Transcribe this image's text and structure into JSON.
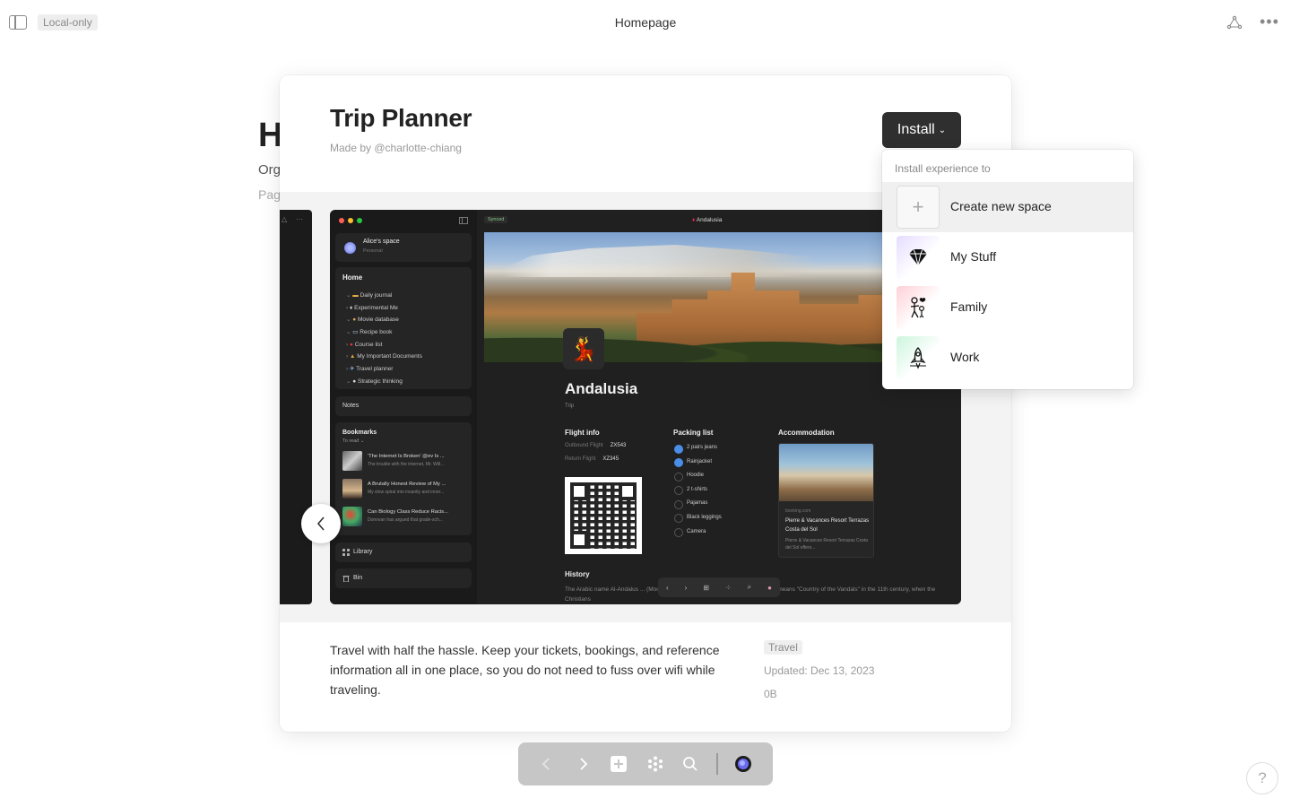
{
  "topbar": {
    "badge": "Local-only",
    "title": "Homepage"
  },
  "background_page": {
    "heading": "H",
    "line1": "Org",
    "line2": "Pag"
  },
  "modal": {
    "title": "Trip Planner",
    "author": "Made by @charlotte-chiang",
    "install_label": "Install",
    "description": "Travel with half the hassle. Keep your tickets, bookings, and reference information all in one place, so you do not need to fuss over wifi while traveling.",
    "tag": "Travel",
    "updated": "Updated: Dec 13, 2023",
    "size": "0B"
  },
  "preview": {
    "space_name": "Alice's space",
    "space_kind": "Personal",
    "home_label": "Home",
    "home_items": [
      "Daily journal",
      "Experimental Me",
      "Movie database",
      "Recipe book",
      "Course list",
      "My Important Documents",
      "Travel planner",
      "Strategic thinking"
    ],
    "notes_label": "Notes",
    "bookmarks_label": "Bookmarks",
    "bookmarks_sub": "To read ⌄",
    "bookmarks": [
      {
        "title": "'The Internet Is Broken' @ev Is ...",
        "sub": "The trouble with the internet, Mr. Will..."
      },
      {
        "title": "A Brutally Honest Review of My ...",
        "sub": "My slow spiral into insanity and inner..."
      },
      {
        "title": "Can Biology Class Reduce Racis...",
        "sub": "Donovan has argued that grade-sch..."
      }
    ],
    "library_label": "Library",
    "bin_label": "Bin",
    "synced": "Synced",
    "breadcrumb": "Andalusia",
    "page_title": "Andalusia",
    "page_sub": "Trip",
    "flight_heading": "Flight info",
    "outbound_label": "Outbound Flight",
    "outbound_value": "ZX543",
    "return_label": "Return Flight",
    "return_value": "XZ345",
    "packing_heading": "Packing list",
    "packing": [
      "2 pairs jeans",
      "Rainjacket",
      "Hoodie",
      "2 t-shirts",
      "Pajamas",
      "Black leggings",
      "Camera"
    ],
    "accommodation_heading": "Accommodation",
    "acc_source": "booking.com",
    "acc_name": "Pierre & Vacances Resort Terrazas Costa del Sol",
    "acc_desc": "Pierre & Vacances Resort Terrazas Costa del Sol offers...",
    "history_heading": "History",
    "history_text": "The Arabic name Al-Andalus ... (Moors) to the entire Iberian Peninsula. It probably means \"Country of the Vandals\" in the 11th century, when the Christians"
  },
  "install_menu": {
    "header": "Install experience to",
    "items": [
      "Create new space",
      "My Stuff",
      "Family",
      "Work"
    ]
  },
  "colors": {
    "accent": "#2f2f2f",
    "checkbox": "#4a8ee8",
    "toolbar": "#c6c6c6"
  }
}
